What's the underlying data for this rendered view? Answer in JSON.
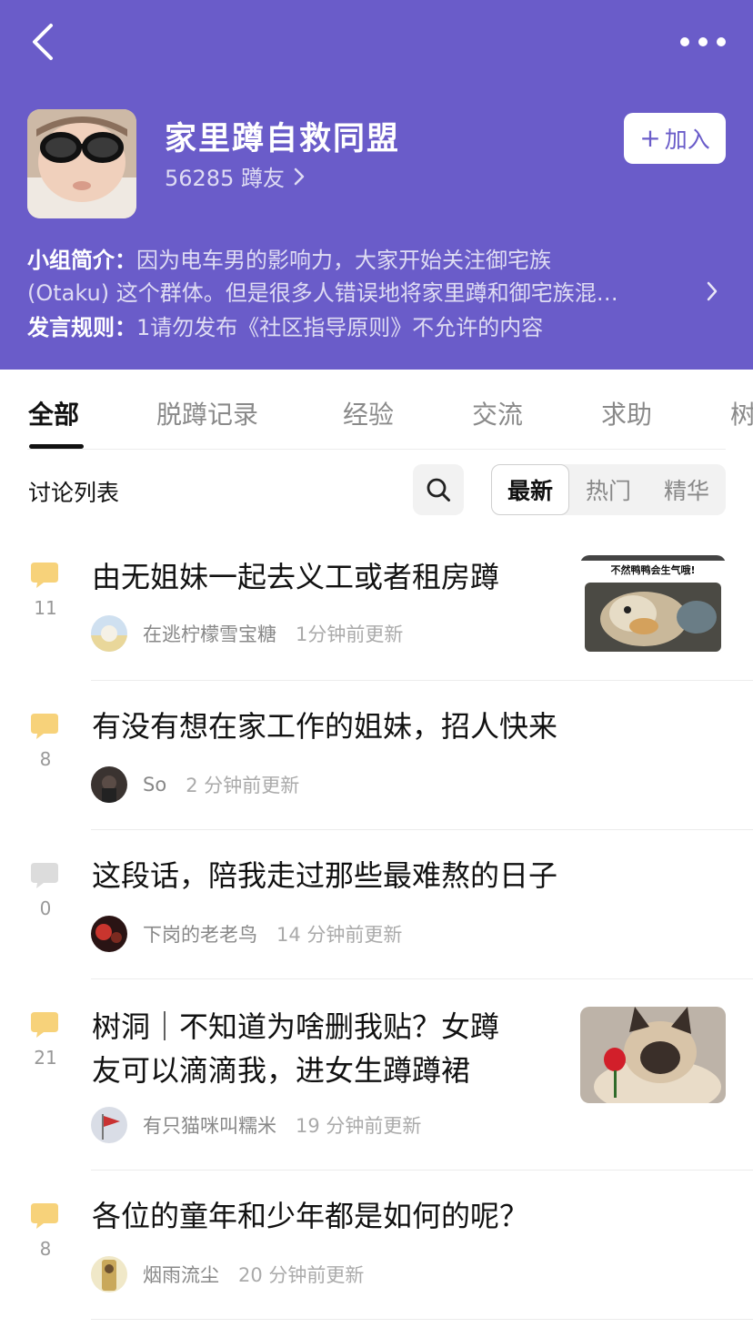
{
  "header": {
    "group_name": "家里蹲自救同盟",
    "member_count": "56285 蹲友",
    "join_label": "加入",
    "intro_label": "小组简介：",
    "intro_line1": "因为电车男的影响力，大家开始关注御宅族",
    "intro_line2": "(Otaku) 这个群体。但是很多人错误地将家里蹲和御宅族混…",
    "rules_label": "发言规则：",
    "rules_text": "1请勿发布《社区指导原则》不允许的内容",
    "bg_color": "#6a5cc9"
  },
  "tabs": [
    "全部",
    "脱蹲记录",
    "经验",
    "交流",
    "求助",
    "树"
  ],
  "filters": {
    "list_title": "讨论列表",
    "sort_options": [
      "最新",
      "热门",
      "精华"
    ],
    "active_sort": "最新"
  },
  "posts": [
    {
      "title": "由无姐妹一起去义工或者租房蹲",
      "comments": "11",
      "author": "在逃柠檬雪宝糖",
      "time": "1分钟前更新",
      "thumb_text": "不然鸭鸭会生气哦!",
      "comment_color": "#f7d27a"
    },
    {
      "title": "有没有想在家工作的姐妹，招人快来",
      "comments": "8",
      "author": "So",
      "time": "2 分钟前更新",
      "comment_color": "#f7d27a"
    },
    {
      "title": "这段话，陪我走过那些最难熬的日子",
      "comments": "0",
      "author": "下岗的老老鸟",
      "time": "14 分钟前更新",
      "comment_color": "#dcdcdc"
    },
    {
      "title_line1": "树洞｜不知道为啥删我贴？女蹲",
      "title_line2": "友可以滴滴我，进女生蹲蹲裙",
      "comments": "21",
      "author": "有只猫咪叫糯米",
      "time": "19 分钟前更新",
      "comment_color": "#f7d27a"
    },
    {
      "title": "各位的童年和少年都是如何的呢？",
      "comments": "8",
      "author": "烟雨流尘",
      "time": "20 分钟前更新",
      "comment_color": "#f7d27a"
    }
  ]
}
